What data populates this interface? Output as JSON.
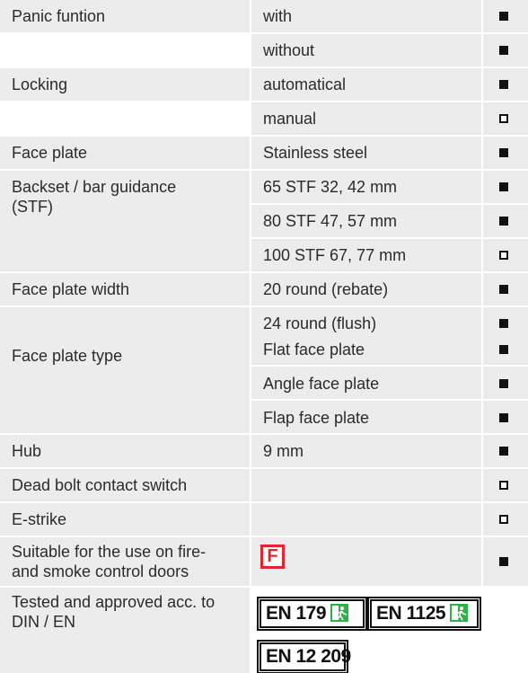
{
  "rows": [
    {
      "label": "Panic funtion",
      "option": "with",
      "mark": "full"
    },
    {
      "label": "",
      "option": "without",
      "mark": "full"
    },
    {
      "label": "Locking",
      "option": "automatical",
      "mark": "full"
    },
    {
      "label": "",
      "option": "manual",
      "mark": "empty"
    },
    {
      "label": "Face plate",
      "option": "Stainless steel",
      "mark": "full"
    },
    {
      "label_line1": "Backset / bar guidance",
      "label_line2": "(STF)",
      "option": "65 STF 32, 42 mm",
      "mark": "full"
    },
    {
      "option": "80 STF 47, 57 mm",
      "mark": "full"
    },
    {
      "option": "100 STF 67, 77 mm",
      "mark": "empty"
    },
    {
      "label": "Face plate width",
      "option": "20 round (rebate)",
      "mark": "full"
    },
    {
      "option": "24 round (flush)",
      "mark": "full"
    },
    {
      "label": "Face plate type",
      "option": "Flat face plate",
      "mark": "full"
    },
    {
      "option": "Angle face plate",
      "mark": "full"
    },
    {
      "option": "Flap face plate",
      "mark": "full"
    },
    {
      "label": "Hub",
      "option": "9 mm",
      "mark": "full"
    },
    {
      "label": "Dead bolt contact switch",
      "option": "",
      "mark": "empty"
    },
    {
      "label": "E-strike",
      "option": "",
      "mark": "empty"
    },
    {
      "label_line1": "Suitable for the use on fire-",
      "label_line2": "and smoke control doors",
      "badge": "F",
      "mark": "full"
    },
    {
      "label_line1": "Tested and approved acc. to",
      "label_line2": "DIN / EN",
      "standards": [
        "EN 179",
        "EN 1125",
        "EN 12 209"
      ]
    }
  ],
  "colors": {
    "stripe": "#ececec",
    "badge_red": "#e3262b",
    "exit_green": "#2fb04a",
    "mark": "#111111"
  },
  "icons": {
    "exit_sign": "emergency-exit-icon",
    "filled_square": "filled-square-icon",
    "hollow_square": "hollow-square-icon"
  }
}
